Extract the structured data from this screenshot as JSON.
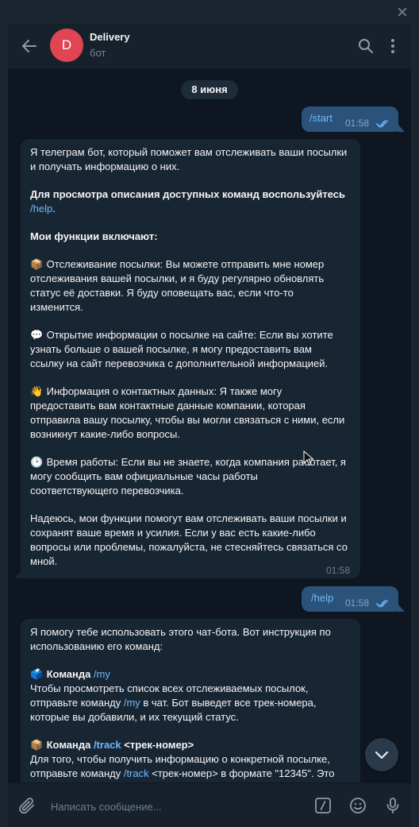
{
  "window": {
    "close_icon": "close-icon"
  },
  "header": {
    "avatar_letter": "D",
    "avatar_color": "#e04553",
    "chat_name": "Delivery",
    "chat_status": "бот"
  },
  "date_separator": "8 июня",
  "messages": [
    {
      "type": "outgoing",
      "text": "/start",
      "time": "01:58",
      "read": true
    },
    {
      "type": "incoming",
      "time": "01:58",
      "p1": "Я телеграм бот, который поможет вам отслеживать ваши посылки и получать информацию о них.",
      "p2_bold": "Для просмотра описания доступных команд воспользуйтесь ",
      "p2_link": "/help",
      "p2_end": ".",
      "p3_bold": "Мои функции включают:",
      "f1_emoji": "📦",
      "f1": " Отслеживание посылки: Вы можете отправить мне номер отслеживания вашей посылки, и я буду регулярно обновлять статус её доставки. Я буду оповещать вас, если что-то изменится.",
      "f2_emoji": "💬",
      "f2": " Открытие информации о посылке на сайте: Если вы хотите узнать больше о вашей посылке, я могу предоставить вам ссылку на сайт перевозчика с дополнительной информацией.",
      "f3_emoji": "👋",
      "f3": " Информация о контактных данных: Я также могу предоставить вам контактные данные компании, которая отправила вашу посылку, чтобы вы могли связаться с ними, если возникнут какие-либо вопросы.",
      "f4_emoji": "🕑",
      "f4": " Время работы: Если вы не знаете, когда компания работает, я могу сообщить вам официальные часы работы соответствующего перевозчика.",
      "closing": "Надеюсь, мои функции помогут вам отслеживать ваши посылки и сохранят ваше время и усилия. Если у вас есть какие-либо вопросы или проблемы, пожалуйста, не стесняйтесь связаться со мной."
    },
    {
      "type": "outgoing",
      "text": "/help",
      "time": "01:58",
      "read": true
    },
    {
      "type": "incoming",
      "intro": "Я помогу тебе использовать этого чат-бота. Вот инструкция по использованию его команд:",
      "c1_emoji": "🗳️",
      "c1_bold": " Команда ",
      "c1_link": "/my",
      "c1_text_a": "Чтобы просмотреть список всех отслеживаемых посылок, отправьте команду ",
      "c1_text_link": "/my",
      "c1_text_b": " в чат. Бот выведет все трек-номера, которые вы добавили, и их текущий статус.",
      "c2_emoji": "📦",
      "c2_bold": " Команда ",
      "c2_link": "/track",
      "c2_arg": " <трек-номер>",
      "c2_text_a": "Для того, чтобы получить информацию о конкретной посылке, отправьте команду ",
      "c2_text_link": "/track",
      "c2_text_b": " <трек-номер> в формате \"12345\". Это"
    }
  ],
  "composer": {
    "placeholder": "Написать сообщение...",
    "attach_icon": "paperclip-icon",
    "commands_icon": "slash-commands-icon",
    "emoji_icon": "smile-icon",
    "mic_icon": "microphone-icon"
  },
  "colors": {
    "panel_bg": "#0e1621",
    "header_bg": "#17212b",
    "outgoing_bubble": "#2b5278",
    "incoming_bubble": "#182533",
    "link": "#71baf9"
  }
}
